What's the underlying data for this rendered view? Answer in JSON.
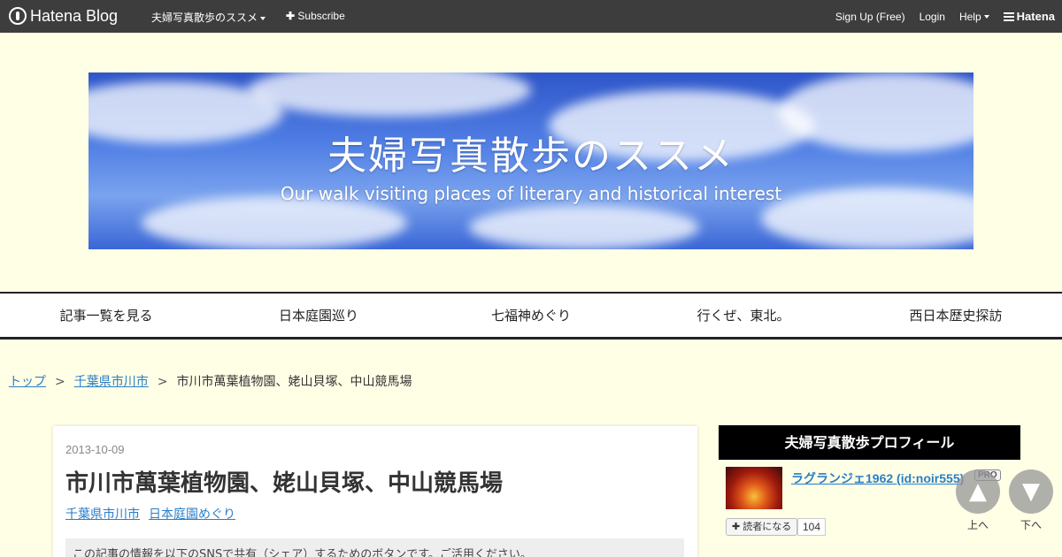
{
  "topbar": {
    "brand": "Hatena Blog",
    "blog_name": "夫婦写真散歩のススメ",
    "subscribe": "Subscribe",
    "signup": "Sign Up (Free)",
    "login": "Login",
    "help": "Help",
    "hatena": "Hatena"
  },
  "banner": {
    "title": "夫婦写真散歩のススメ",
    "subtitle": "Our walk visiting places of literary and historical interest"
  },
  "nav": {
    "items": [
      "記事一覧を見る",
      "日本庭園巡り",
      "七福神めぐり",
      "行くぜ、東北。",
      "西日本歴史探訪"
    ]
  },
  "breadcrumb": {
    "top": "トップ",
    "category": "千葉県市川市",
    "current": "市川市萬葉植物園、姥山貝塚、中山競馬場",
    "sep": ">"
  },
  "article": {
    "date": "2013-10-09",
    "title": "市川市萬葉植物園、姥山貝塚、中山競馬場",
    "categories": [
      "千葉県市川市",
      "日本庭園めぐり"
    ],
    "share_text": "この記事の情報を以下のSNSで共有（シェア）するためのボタンです。ご活用ください。"
  },
  "sidebar": {
    "heading": "夫婦写真散歩プロフィール",
    "profile_name": "ラグランジェ1962 (id:noir555)",
    "pro_badge": "PRO",
    "follow_label": "読者になる",
    "follow_count": "104"
  },
  "scroll": {
    "up_label": "上へ",
    "down_label": "下へ"
  },
  "colors": {
    "topbar_bg": "#3d3d3d",
    "page_bg": "#ffffe6",
    "link": "#2a7ec8"
  }
}
